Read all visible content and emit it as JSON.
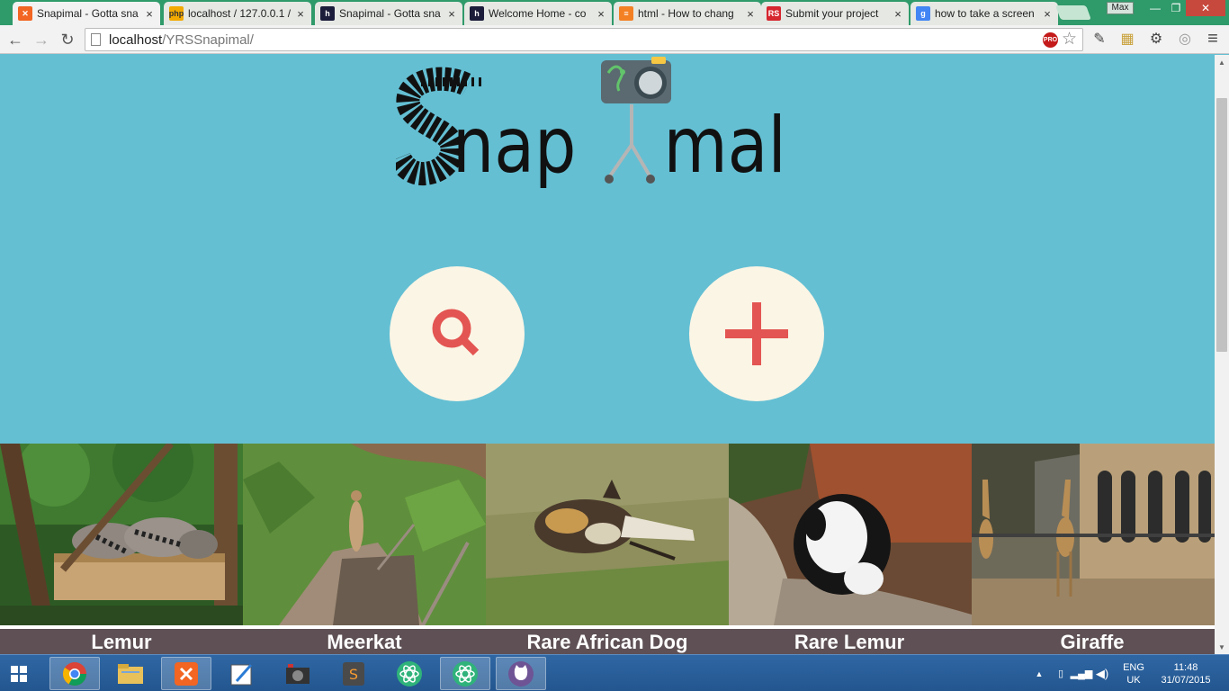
{
  "browser": {
    "tabs": [
      {
        "title": "Snapimal - Gotta sna",
        "icon": "xampp-icon",
        "icon_color": "#f26522",
        "active": true
      },
      {
        "title": "localhost / 127.0.0.1 /",
        "icon": "phpmyadmin-icon",
        "icon_color": "#f2a900",
        "active": false
      },
      {
        "title": "Snapimal - Gotta sna",
        "icon": "h-icon",
        "icon_color": "#1b1b3a",
        "active": false
      },
      {
        "title": "Welcome Home - co",
        "icon": "h-icon",
        "icon_color": "#1b1b3a",
        "active": false
      },
      {
        "title": "html - How to chang",
        "icon": "stackoverflow-icon",
        "icon_color": "#f48024",
        "active": false
      },
      {
        "title": "Submit your project",
        "icon": "rs-icon",
        "icon_color": "#d6262f",
        "active": false
      },
      {
        "title": "how to take a screen",
        "icon": "google-icon",
        "icon_color": "#4285f4",
        "active": false
      }
    ],
    "close_glyph": "×",
    "profile_label": "Max",
    "window_controls": {
      "minimize": "—",
      "restore": "❐",
      "close": "✕"
    },
    "url_host": "localhost",
    "url_path": "/YRSSnapimal/",
    "pro_badge": "PRO",
    "nav_glyphs": {
      "back": "←",
      "forward": "→",
      "reload": "↻"
    },
    "toolbar_glyphs": {
      "star": "☆",
      "eyedropper": "✎",
      "ruler": "▦",
      "settings": "⚙",
      "extension": "◎",
      "menu": "≡"
    }
  },
  "page": {
    "logo_text": "Snapimal",
    "search_button": {
      "icon": "search-icon",
      "color": "#e35552"
    },
    "add_button": {
      "icon": "plus-icon",
      "color": "#e35552"
    },
    "gallery": [
      {
        "caption": "Lemur"
      },
      {
        "caption": "Meerkat"
      },
      {
        "caption": "Rare African Dog"
      },
      {
        "caption": "Rare Lemur"
      },
      {
        "caption": "Giraffe"
      }
    ]
  },
  "taskbar": {
    "apps": [
      "chrome-icon",
      "file-explorer-icon",
      "xampp-icon",
      "pen-icon",
      "video-icon",
      "sublime-text-icon",
      "atom-icon",
      "atom-icon",
      "github-icon"
    ],
    "language": "ENG",
    "region": "UK",
    "time": "11:48",
    "date": "31/07/2015"
  },
  "colors": {
    "page_background": "#64bfd3",
    "button_fill": "#fbf5e5",
    "accent_red": "#e35552",
    "caption_bar": "#5e5054",
    "tab_strip": "#2f9a6a"
  }
}
